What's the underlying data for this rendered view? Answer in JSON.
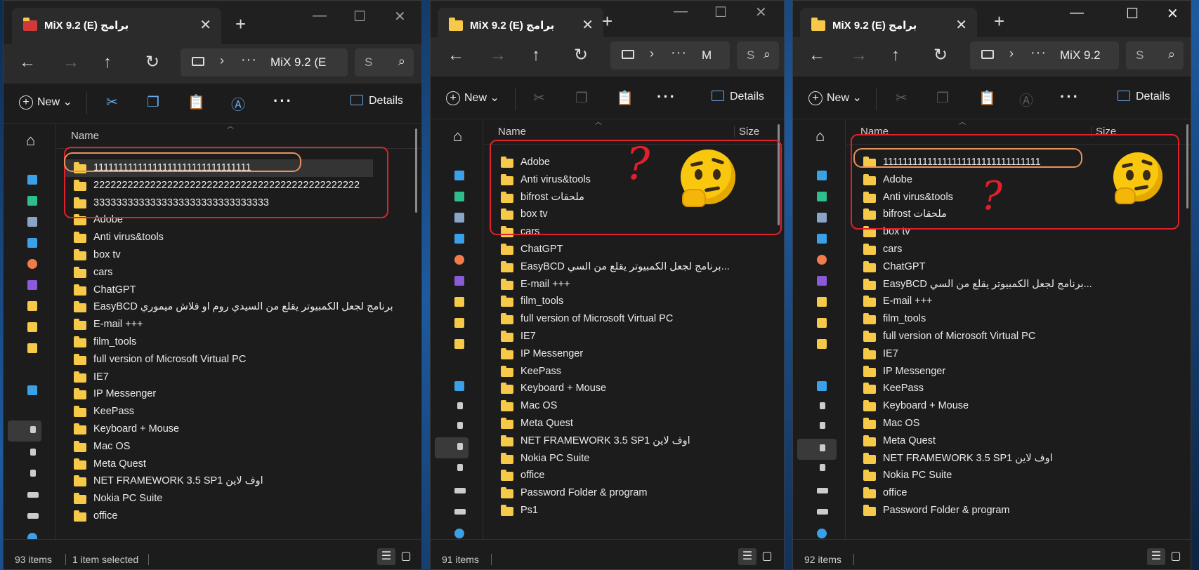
{
  "windows": [
    {
      "tab_title": "MiX 9.2 (E) برامج",
      "address_text": "MiX 9.2 (E",
      "search_placeholder": "S",
      "new_label": "New",
      "details_label": "Details",
      "column_name": "Name",
      "column_size": "",
      "files": [
        "11111111111111111111111111111111",
        "22222222222222222222222222222222222222222222222",
        "3333333333333333333333333333333",
        "Adobe",
        "Anti virus&tools",
        "box tv",
        "cars",
        "ChatGPT",
        "EasyBCD  برنامج لجعل الكمبيوتر يقلع من السيدي روم او فلاش ميموري",
        "E-mail +++",
        "film_tools",
        "full version of Microsoft Virtual PC",
        "IE7",
        "IP Messenger",
        "KeePass",
        "Keyboard + Mouse",
        "Mac OS",
        "Meta Quest",
        "NET FRAMEWORK 3.5 SP1 اوف لاين",
        "Nokia PC Suite",
        "office"
      ],
      "status_count": "93 items",
      "status_selected": "1 item selected"
    },
    {
      "tab_title": "MiX 9.2 (E) برامج",
      "address_text": "M",
      "search_placeholder": "S",
      "new_label": "New",
      "details_label": "Details",
      "column_name": "Name",
      "column_size": "Size",
      "files": [
        "Adobe",
        "Anti virus&tools",
        "bifrost ملحقات",
        "box tv",
        "cars",
        "ChatGPT",
        "EasyBCD  برنامج لجعل الكمبيوتر يقلع من السي...",
        "E-mail +++",
        "film_tools",
        "full version of Microsoft Virtual PC",
        "IE7",
        "IP Messenger",
        "KeePass",
        "Keyboard + Mouse",
        "Mac OS",
        "Meta Quest",
        "NET FRAMEWORK 3.5 SP1 اوف لاين",
        "Nokia PC Suite",
        "office",
        "Password Folder & program",
        "Ps1"
      ],
      "status_count": "91 items",
      "status_selected": ""
    },
    {
      "tab_title": "MiX 9.2 (E) برامج",
      "address_text": "MiX 9.2",
      "search_placeholder": "S",
      "new_label": "New",
      "details_label": "Details",
      "column_name": "Name",
      "column_size": "Size",
      "files": [
        "11111111111111111111111111111111",
        "Adobe",
        "Anti virus&tools",
        "bifrost ملحقات",
        "box tv",
        "cars",
        "ChatGPT",
        "EasyBCD  برنامج لجعل الكمبيوتر يقلع من السي...",
        "E-mail +++",
        "film_tools",
        "full version of Microsoft Virtual PC",
        "IE7",
        "IP Messenger",
        "KeePass",
        "Keyboard + Mouse",
        "Mac OS",
        "Meta Quest",
        "NET FRAMEWORK 3.5 SP1 اوف لاين",
        "Nokia PC Suite",
        "office",
        "Password Folder & program"
      ],
      "status_count": "92 items",
      "status_selected": ""
    }
  ],
  "annotations": {
    "question_mark": "?",
    "thinking_emoji": "thinking-face-icon"
  },
  "colors": {
    "annotation_red": "#e0202a",
    "annotation_orange": "#e8935a",
    "folder_yellow": "#f7c948"
  }
}
